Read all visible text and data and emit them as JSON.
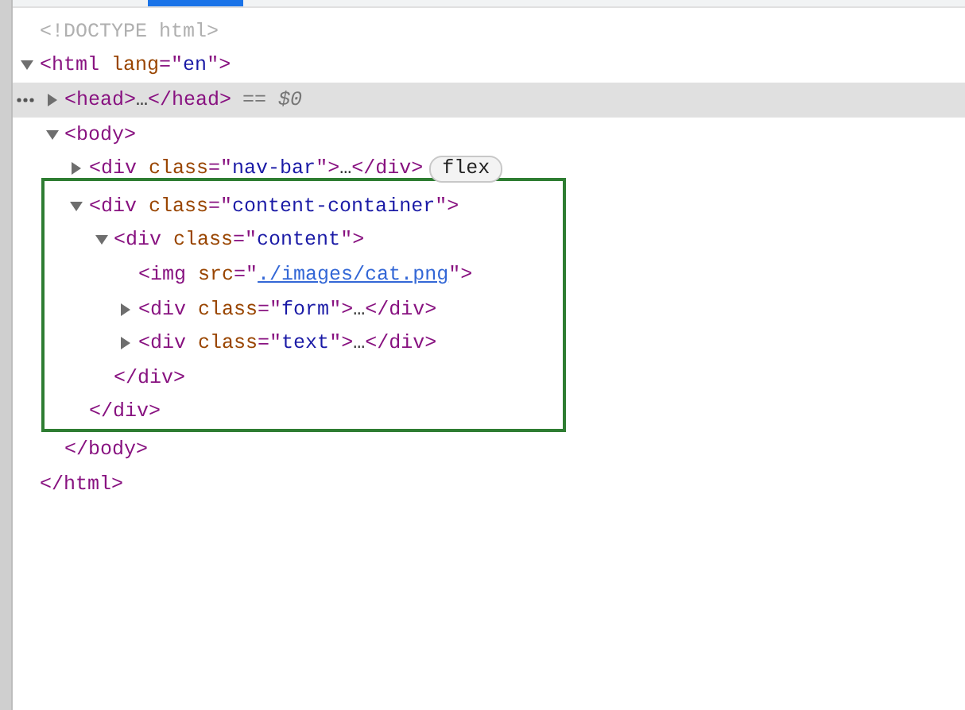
{
  "tree": [
    {
      "kind": "doctype",
      "selected": false,
      "open": [
        {
          "kind": "doctype",
          "text": "<!DOCTYPE html>"
        }
      ]
    },
    {
      "kind": "element",
      "selected": false,
      "expanded": true,
      "open": [
        {
          "kind": "tag",
          "text": "<html"
        },
        {
          "kind": "attr",
          "text": " lang"
        },
        {
          "kind": "punct",
          "text": "=\""
        },
        {
          "kind": "value",
          "text": "en"
        },
        {
          "kind": "punct",
          "text": "\">"
        }
      ],
      "close": [
        {
          "kind": "tag",
          "text": "</html>"
        }
      ],
      "children": [
        {
          "kind": "element",
          "selected": true,
          "expanded": false,
          "open": [
            {
              "kind": "tag",
              "text": "<head>"
            }
          ],
          "ellipsis": "…",
          "close": [
            {
              "kind": "tag",
              "text": "</head>"
            }
          ],
          "note": "== $0"
        },
        {
          "kind": "element",
          "selected": false,
          "expanded": true,
          "open": [
            {
              "kind": "tag",
              "text": "<body>"
            }
          ],
          "close": [
            {
              "kind": "tag",
              "text": "</body>"
            }
          ],
          "children": [
            {
              "kind": "element",
              "selected": false,
              "expanded": false,
              "open": [
                {
                  "kind": "tag",
                  "text": "<div"
                },
                {
                  "kind": "attr",
                  "text": " class"
                },
                {
                  "kind": "punct",
                  "text": "=\""
                },
                {
                  "kind": "value",
                  "text": "nav-bar"
                },
                {
                  "kind": "punct",
                  "text": "\">"
                }
              ],
              "ellipsis": "…",
              "close": [
                {
                  "kind": "tag",
                  "text": "</div>"
                }
              ],
              "badge": "flex"
            },
            {
              "kind": "element",
              "selected": false,
              "highlighted": true,
              "expanded": true,
              "open": [
                {
                  "kind": "tag",
                  "text": "<div"
                },
                {
                  "kind": "attr",
                  "text": " class"
                },
                {
                  "kind": "punct",
                  "text": "=\""
                },
                {
                  "kind": "value",
                  "text": "content-container"
                },
                {
                  "kind": "punct",
                  "text": "\">"
                }
              ],
              "close": [
                {
                  "kind": "tag",
                  "text": "</div>"
                }
              ],
              "children": [
                {
                  "kind": "element",
                  "selected": false,
                  "expanded": true,
                  "open": [
                    {
                      "kind": "tag",
                      "text": "<div"
                    },
                    {
                      "kind": "attr",
                      "text": " class"
                    },
                    {
                      "kind": "punct",
                      "text": "=\""
                    },
                    {
                      "kind": "value",
                      "text": "content"
                    },
                    {
                      "kind": "punct",
                      "text": "\">"
                    }
                  ],
                  "close": [
                    {
                      "kind": "tag",
                      "text": "</div>"
                    }
                  ],
                  "children": [
                    {
                      "kind": "leaf",
                      "selected": false,
                      "open": [
                        {
                          "kind": "tag",
                          "text": "<img"
                        },
                        {
                          "kind": "attr",
                          "text": " src"
                        },
                        {
                          "kind": "punct",
                          "text": "=\""
                        },
                        {
                          "kind": "link",
                          "text": "./images/cat.png"
                        },
                        {
                          "kind": "punct",
                          "text": "\">"
                        }
                      ]
                    },
                    {
                      "kind": "element",
                      "selected": false,
                      "expanded": false,
                      "open": [
                        {
                          "kind": "tag",
                          "text": "<div"
                        },
                        {
                          "kind": "attr",
                          "text": " class"
                        },
                        {
                          "kind": "punct",
                          "text": "=\""
                        },
                        {
                          "kind": "value",
                          "text": "form"
                        },
                        {
                          "kind": "punct",
                          "text": "\">"
                        }
                      ],
                      "ellipsis": "…",
                      "close": [
                        {
                          "kind": "tag",
                          "text": "</div>"
                        }
                      ]
                    },
                    {
                      "kind": "element",
                      "selected": false,
                      "expanded": false,
                      "open": [
                        {
                          "kind": "tag",
                          "text": "<div"
                        },
                        {
                          "kind": "attr",
                          "text": " class"
                        },
                        {
                          "kind": "punct",
                          "text": "=\""
                        },
                        {
                          "kind": "value",
                          "text": "text"
                        },
                        {
                          "kind": "punct",
                          "text": "\">"
                        }
                      ],
                      "ellipsis": "…",
                      "close": [
                        {
                          "kind": "tag",
                          "text": "</div>"
                        }
                      ]
                    }
                  ]
                }
              ]
            }
          ]
        }
      ]
    }
  ]
}
